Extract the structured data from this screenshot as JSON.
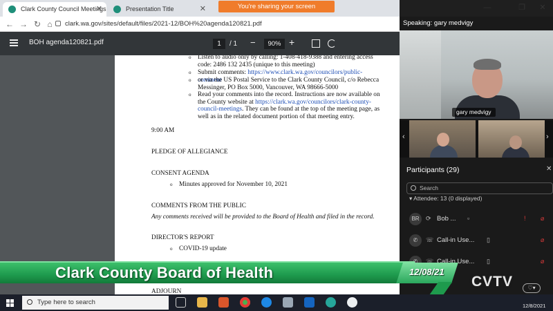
{
  "browser": {
    "tabs": [
      {
        "title": "Clark County Council Meetings |",
        "close": "✕"
      },
      {
        "title": "Presentation Title",
        "close": "✕"
      }
    ],
    "share_banner": "You're sharing your screen",
    "url": "clark.wa.gov/sites/default/files/2021-12/BOH%20agenda120821.pdf"
  },
  "pdf_viewer": {
    "filename": "BOH agenda120821.pdf",
    "page_current": "1",
    "page_total": "/ 1",
    "zoom": "90%"
  },
  "document": {
    "bullets": [
      "Listen to audio only by calling: 1-408-418-9388 and entering access code: 2486 132 2435 (unique to this meeting)",
      "Submit comments:",
      "or via the US Postal Service to the Clark County Council, c/o Rebecca Messinger, PO Box 5000, Vancouver, WA 98666-5000",
      "Read your comments into the record. Instructions are now available on the County website at"
    ],
    "comments_link": "https://www.clark.wa.gov/councilors/public-comment",
    "meetings_link": "https://clark.wa.gov/councilors/clark-county-council-meetings",
    "read_suffix": ". They can be found at the top of the meeting page, as well as in the related document portion of that meeting entry.",
    "time": "9:00 AM",
    "pledge": "PLEDGE OF ALLEGIANCE",
    "consent": "CONSENT AGENDA",
    "consent_item": "Minutes approved for November 10, 2021",
    "comments_heading": "COMMENTS FROM THE PUBLIC",
    "comments_note": "Any comments received will be provided to the Board of Health and filed in the record.",
    "director": "DIRECTOR'S REPORT",
    "director_item": "COVID-19 update",
    "adjourn": "ADJOURN"
  },
  "zoom": {
    "speaking_label": "Speaking: gary medvigy",
    "speaker_name": "gary medvigy",
    "participants_title": "Participants (29)",
    "search_placeholder": "Search",
    "attendee_header": "Attendee: 13 (0 displayed)",
    "participants": [
      {
        "initials": "BR",
        "name": "Bob ..."
      },
      {
        "initials": "",
        "name": "Call-in Use..."
      },
      {
        "initials": "",
        "name": "Call-in Use..."
      }
    ]
  },
  "broadcast": {
    "title": "Clark County Board of Health",
    "date": "12/08/21",
    "logo": "CVTV"
  },
  "taskbar": {
    "search_placeholder": "Type here to search",
    "date": "12/8/2021"
  },
  "colors": {
    "share_banner": "#f07c2b",
    "lower_third": "#1e9a4d",
    "link": "#1f4fb5",
    "alert_red": "#e03b3b"
  }
}
